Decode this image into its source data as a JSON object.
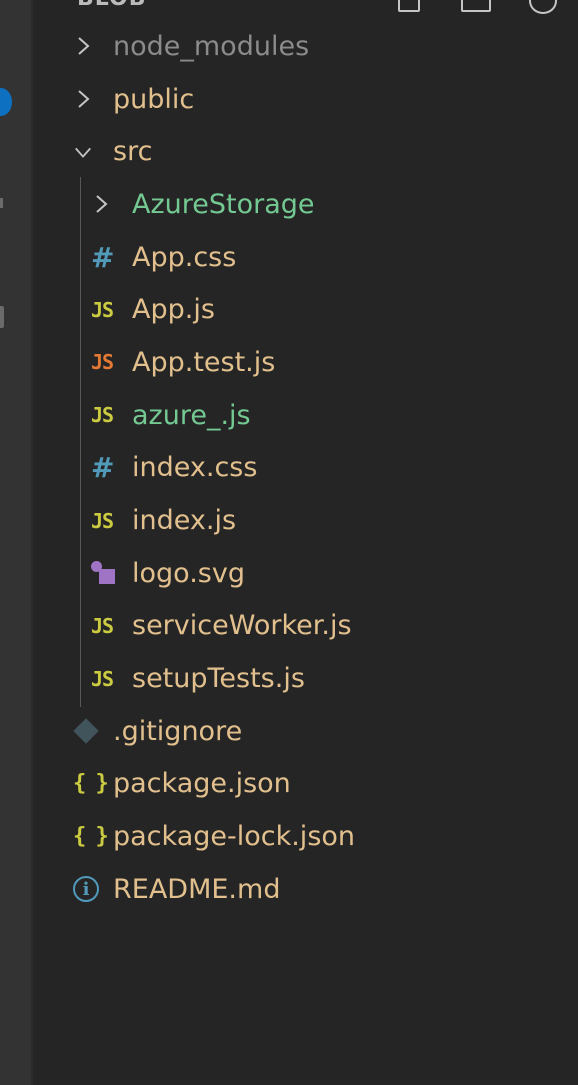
{
  "explorer": {
    "title": "BLOB",
    "header_actions": [
      "new-file-icon",
      "new-folder-icon",
      "refresh-icon"
    ]
  },
  "activity_bar": {
    "badge_color": "#0e70c0"
  },
  "tree": [
    {
      "label": "node_modules",
      "type": "folder",
      "expanded": false,
      "level": 0,
      "color": "#8b8b8b"
    },
    {
      "label": "public",
      "type": "folder",
      "expanded": false,
      "level": 0,
      "color": "#e2c08d"
    },
    {
      "label": "src",
      "type": "folder",
      "expanded": true,
      "level": 0,
      "color": "#e2c08d"
    },
    {
      "label": "AzureStorage",
      "type": "folder",
      "expanded": false,
      "level": 1,
      "color": "#73c991"
    },
    {
      "label": "App.css",
      "type": "file",
      "icon": "hash-icon",
      "icon_text": "#",
      "level": 1,
      "color": "#e2c08d"
    },
    {
      "label": "App.js",
      "type": "file",
      "icon": "js-icon",
      "icon_text": "JS",
      "level": 1,
      "color": "#e2c08d"
    },
    {
      "label": "App.test.js",
      "type": "file",
      "icon": "js-test-icon",
      "icon_text": "JS",
      "level": 1,
      "color": "#e2c08d"
    },
    {
      "label": "azure_.js",
      "type": "file",
      "icon": "js-icon",
      "icon_text": "JS",
      "level": 1,
      "color": "#73c991"
    },
    {
      "label": "index.css",
      "type": "file",
      "icon": "hash-icon",
      "icon_text": "#",
      "level": 1,
      "color": "#e2c08d"
    },
    {
      "label": "index.js",
      "type": "file",
      "icon": "js-icon",
      "icon_text": "JS",
      "level": 1,
      "color": "#e2c08d"
    },
    {
      "label": "logo.svg",
      "type": "file",
      "icon": "svg-file-icon",
      "level": 1,
      "color": "#e2c08d"
    },
    {
      "label": "serviceWorker.js",
      "type": "file",
      "icon": "js-icon",
      "icon_text": "JS",
      "level": 1,
      "color": "#e2c08d"
    },
    {
      "label": "setupTests.js",
      "type": "file",
      "icon": "js-icon",
      "icon_text": "JS",
      "level": 1,
      "color": "#e2c08d"
    },
    {
      "label": ".gitignore",
      "type": "file",
      "icon": "git-icon",
      "level": 0,
      "color": "#e2c08d"
    },
    {
      "label": "package.json",
      "type": "file",
      "icon": "braces-icon",
      "icon_text": "{ }",
      "level": 0,
      "color": "#e2c08d"
    },
    {
      "label": "package-lock.json",
      "type": "file",
      "icon": "braces-icon",
      "icon_text": "{ }",
      "level": 0,
      "color": "#e2c08d"
    },
    {
      "label": "README.md",
      "type": "file",
      "icon": "info-icon",
      "icon_text": "i",
      "level": 0,
      "color": "#e2c08d"
    }
  ]
}
